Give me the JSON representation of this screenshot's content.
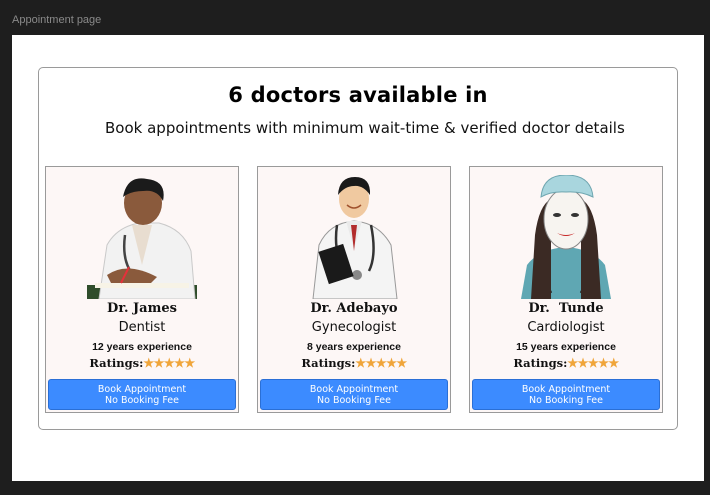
{
  "frame": {
    "label": "Appointment page"
  },
  "header": {
    "title": "6 doctors available in",
    "subtitle": "Book appointments with minimum wait-time & verified doctor details"
  },
  "doctors": [
    {
      "name": "Dr. James",
      "specialty": "Dentist",
      "experience": "12 years experience",
      "ratings_label": "Ratings:",
      "stars": "★★★★★",
      "rating": 5,
      "button_line1": "Book Appointment",
      "button_line2": "No Booking Fee"
    },
    {
      "name": "Dr. Adebayo",
      "specialty": "Gynecologist",
      "experience": "8 years experience",
      "ratings_label": "Ratings:",
      "stars": "★★★★★",
      "rating": 5,
      "button_line1": "Book Appointment",
      "button_line2": "No Booking Fee"
    },
    {
      "name": "Dr.  Tunde",
      "specialty": "Cardiologist",
      "experience": "15 years experience",
      "ratings_label": "Ratings:",
      "stars": "★★★★★",
      "rating": 5,
      "button_line1": "Book Appointment",
      "button_line2": "No Booking Fee"
    }
  ],
  "colors": {
    "button": "#3c8bff",
    "star": "#f0a53a",
    "card_bg": "#fdf7f6"
  }
}
